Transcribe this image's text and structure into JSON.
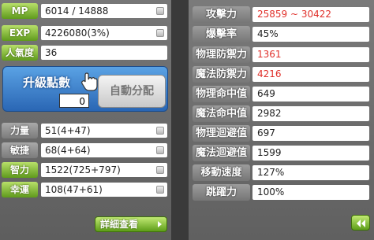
{
  "left": {
    "top_stats": [
      {
        "label": "MP",
        "value": "6014 / 14888"
      },
      {
        "label": "EXP",
        "value": "4226080(3%)"
      },
      {
        "label": "人氣度",
        "value": "36"
      }
    ],
    "ability_points": {
      "title": "升級點數",
      "value": "0",
      "auto_button": "自動分配"
    },
    "base_stats": [
      {
        "label": "力量",
        "value": "51(4+47)"
      },
      {
        "label": "敏捷",
        "value": "68(4+64)"
      },
      {
        "label": "智力",
        "value": "1522(725+797)"
      },
      {
        "label": "幸運",
        "value": "108(47+61)"
      }
    ],
    "detail_button": "詳細查看"
  },
  "right": {
    "stats": [
      {
        "label": "攻擊力",
        "value": "25859 ~ 30422",
        "color": "#e0302a"
      },
      {
        "label": "爆擊率",
        "value": "45%"
      },
      {
        "label": "物理防禦力",
        "value": "1361",
        "color": "#e0302a"
      },
      {
        "label": "魔法防禦力",
        "value": "4216",
        "color": "#e0302a"
      },
      {
        "label": "物理命中值",
        "value": "649"
      },
      {
        "label": "魔法命中值",
        "value": "2982"
      },
      {
        "label": "物理迴避值",
        "value": "697"
      },
      {
        "label": "魔法迴避值",
        "value": "1599"
      },
      {
        "label": "移動速度",
        "value": "127%"
      },
      {
        "label": "跳躍力",
        "value": "100%"
      }
    ]
  }
}
